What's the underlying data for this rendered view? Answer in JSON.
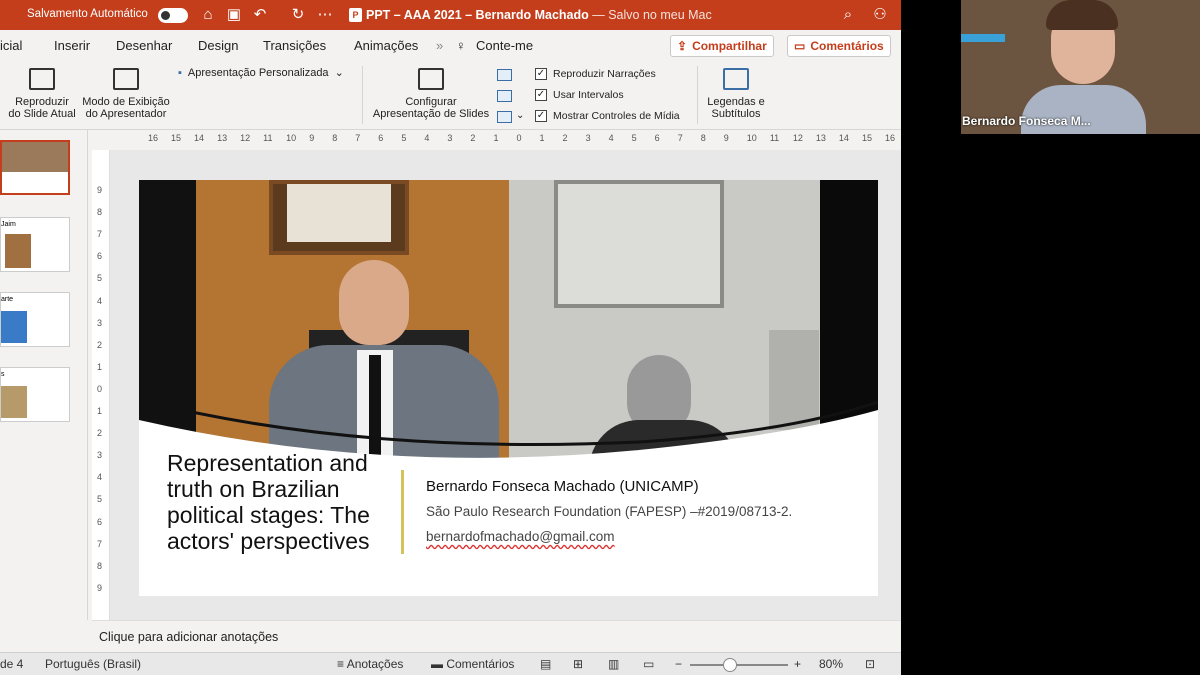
{
  "titlebar": {
    "autosave_label": "Salvamento Automático",
    "doc_title": "PPT – AAA 2021 – Bernardo Machado",
    "saved_status": "— Salvo no meu Mac",
    "ppt_badge": "P"
  },
  "menu": {
    "items": [
      "icial",
      "Inserir",
      "Desenhar",
      "Design",
      "Transições",
      "Animações",
      "Conte-me"
    ],
    "overflow": "»",
    "share_label": "Compartilhar",
    "comments_label": "Comentários"
  },
  "ribbon": {
    "play_current": "Reproduzir\ndo Slide Atual",
    "presenter_view": "Modo de Exibição\ndo Apresentador",
    "custom_show": "Apresentação Personalizada",
    "setup_show": "Configurar\nApresentação de Slides",
    "checkboxes": [
      {
        "label": "Reproduzir Narrações",
        "checked": true
      },
      {
        "label": "Usar Intervalos",
        "checked": true
      },
      {
        "label": "Mostrar Controles de Mídia",
        "checked": true
      }
    ],
    "captions": "Legendas e\nSubtítulos"
  },
  "ruler": {
    "h_ticks": [
      "16",
      "15",
      "14",
      "13",
      "12",
      "11",
      "10",
      "9",
      "8",
      "7",
      "6",
      "5",
      "4",
      "3",
      "2",
      "1",
      "0",
      "1",
      "2",
      "3",
      "4",
      "5",
      "6",
      "7",
      "8",
      "9",
      "10",
      "11",
      "12",
      "13",
      "14",
      "15",
      "16"
    ],
    "v_ticks": [
      "9",
      "8",
      "7",
      "6",
      "5",
      "4",
      "3",
      "2",
      "1",
      "0",
      "1",
      "2",
      "3",
      "4",
      "5",
      "6",
      "7",
      "8",
      "9"
    ]
  },
  "thumbnails": [
    {
      "label": ""
    },
    {
      "label": "Jaim"
    },
    {
      "label": "arte"
    },
    {
      "label": "s"
    }
  ],
  "slide": {
    "title": "Representation and truth on Brazilian political stages: The actors' perspectives",
    "author": "Bernardo Fonseca Machado (UNICAMP)",
    "funding": "São Paulo Research Foundation (FAPESP) –#2019/08713-2.",
    "email": "bernardofmachado@gmail.com"
  },
  "notes_placeholder": "Clique para adicionar anotações",
  "status": {
    "slide_count": "de 4",
    "language": "Português (Brasil)",
    "notes_btn": "Anotações",
    "comments_btn": "Comentários",
    "zoom": "80%",
    "zoom_level_percent": 80
  },
  "video": {
    "participant_name": "Bernardo Fonseca M..."
  }
}
